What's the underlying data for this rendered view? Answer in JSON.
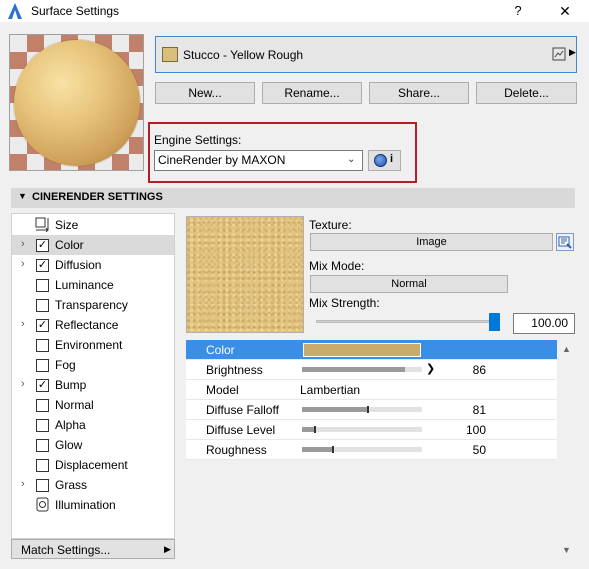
{
  "window": {
    "title": "Surface Settings",
    "help": "?",
    "close": "✕"
  },
  "surface": {
    "name": "Stucco - Yellow Rough",
    "swatch_color": "#d8c07c"
  },
  "buttons": {
    "new": "New...",
    "rename": "Rename...",
    "share": "Share...",
    "delete": "Delete..."
  },
  "engine": {
    "label": "Engine Settings:",
    "selected": "CineRender by MAXON",
    "info": "i"
  },
  "section": {
    "title": "CINERENDER SETTINGS"
  },
  "channels": [
    {
      "label": "Size",
      "icon": "size-icon",
      "has_arrow": false,
      "checkbox": false,
      "checked": false,
      "selected": false
    },
    {
      "label": "Color",
      "has_arrow": true,
      "checkbox": true,
      "checked": true,
      "selected": true
    },
    {
      "label": "Diffusion",
      "has_arrow": true,
      "checkbox": true,
      "checked": true,
      "selected": false
    },
    {
      "label": "Luminance",
      "has_arrow": false,
      "checkbox": true,
      "checked": false,
      "selected": false
    },
    {
      "label": "Transparency",
      "has_arrow": false,
      "checkbox": true,
      "checked": false,
      "selected": false
    },
    {
      "label": "Reflectance",
      "has_arrow": true,
      "checkbox": true,
      "checked": true,
      "selected": false
    },
    {
      "label": "Environment",
      "has_arrow": false,
      "checkbox": true,
      "checked": false,
      "selected": false
    },
    {
      "label": "Fog",
      "has_arrow": false,
      "checkbox": true,
      "checked": false,
      "selected": false
    },
    {
      "label": "Bump",
      "has_arrow": true,
      "checkbox": true,
      "checked": true,
      "selected": false
    },
    {
      "label": "Normal",
      "has_arrow": false,
      "checkbox": true,
      "checked": false,
      "selected": false
    },
    {
      "label": "Alpha",
      "has_arrow": false,
      "checkbox": true,
      "checked": false,
      "selected": false
    },
    {
      "label": "Glow",
      "has_arrow": false,
      "checkbox": true,
      "checked": false,
      "selected": false
    },
    {
      "label": "Displacement",
      "has_arrow": false,
      "checkbox": true,
      "checked": false,
      "selected": false
    },
    {
      "label": "Grass",
      "has_arrow": true,
      "checkbox": true,
      "checked": false,
      "selected": false
    },
    {
      "label": "Illumination",
      "icon": "illumination-icon",
      "has_arrow": false,
      "checkbox": false,
      "checked": false,
      "selected": false
    }
  ],
  "match_settings": "Match Settings...",
  "texture": {
    "label": "Texture:",
    "button": "Image"
  },
  "mix_mode": {
    "label": "Mix Mode:",
    "value": "Normal"
  },
  "mix_strength": {
    "label": "Mix Strength:",
    "value": "100.00",
    "fraction": 1.0
  },
  "properties": {
    "color_label": "Color",
    "color_value": "#c9ab6c",
    "brightness_label": "Brightness",
    "brightness_value": "86",
    "brightness_fraction": 0.86,
    "model_label": "Model",
    "model_value": "Lambertian",
    "falloff_label": "Diffuse Falloff",
    "falloff_value": "81",
    "falloff_fraction": 0.54,
    "level_label": "Diffuse Level",
    "level_value": "100",
    "level_fraction": 0.1,
    "roughness_label": "Roughness",
    "roughness_value": "50",
    "roughness_fraction": 0.25
  },
  "colors": {
    "accent": "#3b8ee5",
    "highlight_border": "#b21f24"
  }
}
